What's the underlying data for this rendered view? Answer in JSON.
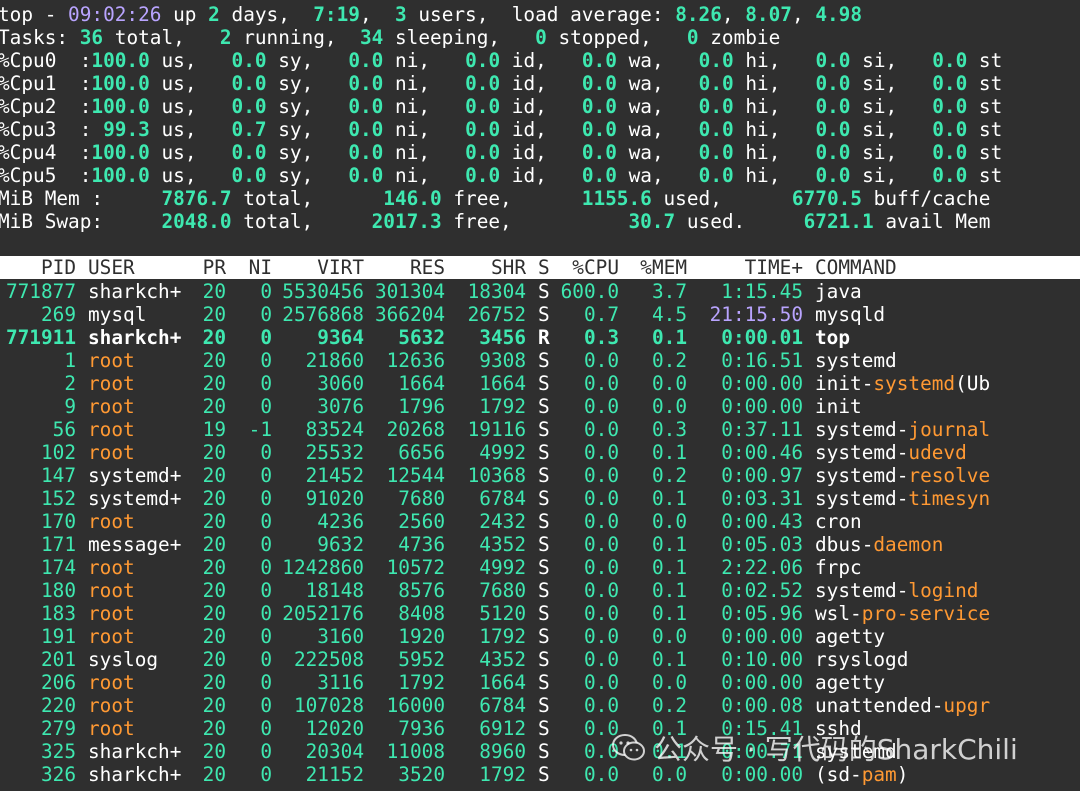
{
  "summary": {
    "line1": [
      {
        "t": "top - ",
        "c": "wh"
      },
      {
        "t": "09:02:26",
        "c": "pu"
      },
      {
        "t": " up ",
        "c": "wh"
      },
      {
        "t": "2",
        "c": "hl"
      },
      {
        "t": " days,  ",
        "c": "wh"
      },
      {
        "t": "7:19",
        "c": "hl"
      },
      {
        "t": ",  ",
        "c": "wh"
      },
      {
        "t": "3",
        "c": "hl"
      },
      {
        "t": " users,  load average: ",
        "c": "wh"
      },
      {
        "t": "8.26",
        "c": "hl"
      },
      {
        "t": ", ",
        "c": "wh"
      },
      {
        "t": "8.07",
        "c": "hl"
      },
      {
        "t": ", ",
        "c": "wh"
      },
      {
        "t": "4.98",
        "c": "hl"
      }
    ],
    "tasks": {
      "total": "36",
      "running": "2",
      "sleeping": "34",
      "stopped": "0",
      "zombie": "0"
    },
    "cpus": [
      {
        "label": "%Cpu0",
        "us": "100.0",
        "sy": "0.0",
        "ni": "0.0",
        "id": "0.0",
        "wa": "0.0",
        "hi": "0.0",
        "si": "0.0",
        "st": "0.0"
      },
      {
        "label": "%Cpu1",
        "us": "100.0",
        "sy": "0.0",
        "ni": "0.0",
        "id": "0.0",
        "wa": "0.0",
        "hi": "0.0",
        "si": "0.0",
        "st": "0.0"
      },
      {
        "label": "%Cpu2",
        "us": "100.0",
        "sy": "0.0",
        "ni": "0.0",
        "id": "0.0",
        "wa": "0.0",
        "hi": "0.0",
        "si": "0.0",
        "st": "0.0"
      },
      {
        "label": "%Cpu3",
        "us": "99.3",
        "sy": "0.7",
        "ni": "0.0",
        "id": "0.0",
        "wa": "0.0",
        "hi": "0.0",
        "si": "0.0",
        "st": "0.0"
      },
      {
        "label": "%Cpu4",
        "us": "100.0",
        "sy": "0.0",
        "ni": "0.0",
        "id": "0.0",
        "wa": "0.0",
        "hi": "0.0",
        "si": "0.0",
        "st": "0.0"
      },
      {
        "label": "%Cpu5",
        "us": "100.0",
        "sy": "0.0",
        "ni": "0.0",
        "id": "0.0",
        "wa": "0.0",
        "hi": "0.0",
        "si": "0.0",
        "st": "0.0"
      }
    ],
    "mem": {
      "label": "MiB Mem :",
      "total": "7876.7",
      "free": "146.0",
      "used": "1155.6",
      "buff_cache": "6770.5"
    },
    "swap": {
      "label": "MiB Swap:",
      "total": "2048.0",
      "free": "2017.3",
      "used": "30.7",
      "avail": "6721.1"
    }
  },
  "table": {
    "headers": [
      "PID",
      "USER",
      "PR",
      "NI",
      "VIRT",
      "RES",
      "SHR",
      "S",
      "%CPU",
      "%MEM",
      "TIME+",
      "COMMAND"
    ],
    "rows": [
      {
        "pid": "771877",
        "user": "sharkch+",
        "pr": "20",
        "ni": "0",
        "virt": "5530456",
        "res": "301304",
        "shr": "18304",
        "s": "S",
        "cpu": "600.0",
        "mem": "3.7",
        "time_a": "1",
        "time_b": ":15.45",
        "cmd": [
          {
            "t": "java",
            "c": ""
          }
        ]
      },
      {
        "pid": "269",
        "user": "mysql",
        "pr": "20",
        "ni": "0",
        "virt": "2576868",
        "res": "366204",
        "shr": "26752",
        "s": "S",
        "cpu": "0.7",
        "mem": "4.5",
        "time_a": "21",
        "time_b": ":15.50",
        "time_purple": true,
        "cmd": [
          {
            "t": "mysqld",
            "c": ""
          }
        ]
      },
      {
        "pid": "771911",
        "user": "sharkch+",
        "pr": "20",
        "ni": "0",
        "virt": "9364",
        "res": "5632",
        "shr": "3456",
        "s": "R",
        "cpu": "0.3",
        "mem": "0.1",
        "time_a": "0",
        "time_b": ":00.01",
        "bold": true,
        "cmd": [
          {
            "t": "top",
            "c": ""
          }
        ]
      },
      {
        "pid": "1",
        "user": "root",
        "pr": "20",
        "ni": "0",
        "virt": "21860",
        "res": "12636",
        "shr": "9308",
        "s": "S",
        "cpu": "0.0",
        "mem": "0.2",
        "time_a": "0",
        "time_b": ":16.51",
        "cmd": [
          {
            "t": "systemd",
            "c": ""
          }
        ]
      },
      {
        "pid": "2",
        "user": "root",
        "pr": "20",
        "ni": "0",
        "virt": "3060",
        "res": "1664",
        "shr": "1664",
        "s": "S",
        "cpu": "0.0",
        "mem": "0.0",
        "time_a": "0",
        "time_b": ":00.00",
        "cmd": [
          {
            "t": "init-",
            "c": ""
          },
          {
            "t": "systemd",
            "c": "or"
          },
          {
            "t": "(Ub",
            "c": ""
          }
        ]
      },
      {
        "pid": "9",
        "user": "root",
        "pr": "20",
        "ni": "0",
        "virt": "3076",
        "res": "1796",
        "shr": "1792",
        "s": "S",
        "cpu": "0.0",
        "mem": "0.0",
        "time_a": "0",
        "time_b": ":00.00",
        "cmd": [
          {
            "t": "init",
            "c": ""
          }
        ]
      },
      {
        "pid": "56",
        "user": "root",
        "pr": "19",
        "ni": "-1",
        "virt": "83524",
        "res": "20268",
        "shr": "19116",
        "s": "S",
        "cpu": "0.0",
        "mem": "0.3",
        "time_a": "0",
        "time_b": ":37.11",
        "cmd": [
          {
            "t": "systemd-",
            "c": ""
          },
          {
            "t": "journal",
            "c": "or"
          }
        ]
      },
      {
        "pid": "102",
        "user": "root",
        "pr": "20",
        "ni": "0",
        "virt": "25532",
        "res": "6656",
        "shr": "4992",
        "s": "S",
        "cpu": "0.0",
        "mem": "0.1",
        "time_a": "0",
        "time_b": ":00.46",
        "cmd": [
          {
            "t": "systemd-",
            "c": ""
          },
          {
            "t": "udevd",
            "c": "or"
          }
        ]
      },
      {
        "pid": "147",
        "user": "systemd+",
        "pr": "20",
        "ni": "0",
        "virt": "21452",
        "res": "12544",
        "shr": "10368",
        "s": "S",
        "cpu": "0.0",
        "mem": "0.2",
        "time_a": "0",
        "time_b": ":00.97",
        "cmd": [
          {
            "t": "systemd-",
            "c": ""
          },
          {
            "t": "resolve",
            "c": "or"
          }
        ]
      },
      {
        "pid": "152",
        "user": "systemd+",
        "pr": "20",
        "ni": "0",
        "virt": "91020",
        "res": "7680",
        "shr": "6784",
        "s": "S",
        "cpu": "0.0",
        "mem": "0.1",
        "time_a": "0",
        "time_b": ":03.31",
        "cmd": [
          {
            "t": "systemd-",
            "c": ""
          },
          {
            "t": "timesyn",
            "c": "or"
          }
        ]
      },
      {
        "pid": "170",
        "user": "root",
        "pr": "20",
        "ni": "0",
        "virt": "4236",
        "res": "2560",
        "shr": "2432",
        "s": "S",
        "cpu": "0.0",
        "mem": "0.0",
        "time_a": "0",
        "time_b": ":00.43",
        "cmd": [
          {
            "t": "cron",
            "c": ""
          }
        ]
      },
      {
        "pid": "171",
        "user": "message+",
        "pr": "20",
        "ni": "0",
        "virt": "9632",
        "res": "4736",
        "shr": "4352",
        "s": "S",
        "cpu": "0.0",
        "mem": "0.1",
        "time_a": "0",
        "time_b": ":05.03",
        "cmd": [
          {
            "t": "dbus-",
            "c": ""
          },
          {
            "t": "daemon",
            "c": "or"
          }
        ]
      },
      {
        "pid": "174",
        "user": "root",
        "pr": "20",
        "ni": "0",
        "virt": "1242860",
        "res": "10572",
        "shr": "4992",
        "s": "S",
        "cpu": "0.0",
        "mem": "0.1",
        "time_a": "2",
        "time_b": ":22.06",
        "cmd": [
          {
            "t": "frpc",
            "c": ""
          }
        ]
      },
      {
        "pid": "180",
        "user": "root",
        "pr": "20",
        "ni": "0",
        "virt": "18148",
        "res": "8576",
        "shr": "7680",
        "s": "S",
        "cpu": "0.0",
        "mem": "0.1",
        "time_a": "0",
        "time_b": ":02.52",
        "cmd": [
          {
            "t": "systemd-",
            "c": ""
          },
          {
            "t": "logind",
            "c": "or"
          }
        ]
      },
      {
        "pid": "183",
        "user": "root",
        "pr": "20",
        "ni": "0",
        "virt": "2052176",
        "res": "8408",
        "shr": "5120",
        "s": "S",
        "cpu": "0.0",
        "mem": "0.1",
        "time_a": "0",
        "time_b": ":05.96",
        "cmd": [
          {
            "t": "wsl-",
            "c": ""
          },
          {
            "t": "pro-service",
            "c": "or"
          }
        ]
      },
      {
        "pid": "191",
        "user": "root",
        "pr": "20",
        "ni": "0",
        "virt": "3160",
        "res": "1920",
        "shr": "1792",
        "s": "S",
        "cpu": "0.0",
        "mem": "0.0",
        "time_a": "0",
        "time_b": ":00.00",
        "cmd": [
          {
            "t": "agetty",
            "c": ""
          }
        ]
      },
      {
        "pid": "201",
        "user": "syslog",
        "pr": "20",
        "ni": "0",
        "virt": "222508",
        "res": "5952",
        "shr": "4352",
        "s": "S",
        "cpu": "0.0",
        "mem": "0.1",
        "time_a": "0",
        "time_b": ":10.00",
        "cmd": [
          {
            "t": "rsyslogd",
            "c": ""
          }
        ]
      },
      {
        "pid": "206",
        "user": "root",
        "pr": "20",
        "ni": "0",
        "virt": "3116",
        "res": "1792",
        "shr": "1664",
        "s": "S",
        "cpu": "0.0",
        "mem": "0.0",
        "time_a": "0",
        "time_b": ":00.00",
        "cmd": [
          {
            "t": "agetty",
            "c": ""
          }
        ]
      },
      {
        "pid": "220",
        "user": "root",
        "pr": "20",
        "ni": "0",
        "virt": "107028",
        "res": "16000",
        "shr": "6784",
        "s": "S",
        "cpu": "0.0",
        "mem": "0.2",
        "time_a": "0",
        "time_b": ":00.08",
        "cmd": [
          {
            "t": "unattended-",
            "c": ""
          },
          {
            "t": "upgr",
            "c": "or"
          }
        ]
      },
      {
        "pid": "279",
        "user": "root",
        "pr": "20",
        "ni": "0",
        "virt": "12020",
        "res": "7936",
        "shr": "6912",
        "s": "S",
        "cpu": "0.0",
        "mem": "0.1",
        "time_a": "0",
        "time_b": ":15.41",
        "cmd": [
          {
            "t": "sshd",
            "c": ""
          }
        ]
      },
      {
        "pid": "325",
        "user": "sharkch+",
        "pr": "20",
        "ni": "0",
        "virt": "20304",
        "res": "11008",
        "shr": "8960",
        "s": "S",
        "cpu": "0.0",
        "mem": "0.1",
        "time_a": "0",
        "time_b": ":00.71",
        "cmd": [
          {
            "t": "systemd",
            "c": ""
          }
        ]
      },
      {
        "pid": "326",
        "user": "sharkch+",
        "pr": "20",
        "ni": "0",
        "virt": "21152",
        "res": "3520",
        "shr": "1792",
        "s": "S",
        "cpu": "0.0",
        "mem": "0.0",
        "time_a": "0",
        "time_b": ":00.00",
        "cmd": [
          {
            "t": "(sd-",
            "c": ""
          },
          {
            "t": "pam",
            "c": "or"
          },
          {
            "t": ")",
            "c": ""
          }
        ]
      }
    ]
  },
  "watermark": {
    "text": "公众号 · 写代码的SharkChili",
    "icon": "wechat-icon"
  },
  "colors": {
    "background": "#2f2f2f",
    "highlight": "#3ee8b0",
    "purple": "#b9a4ff",
    "orange": "#ff9933",
    "header_bar": "#ffffff"
  }
}
